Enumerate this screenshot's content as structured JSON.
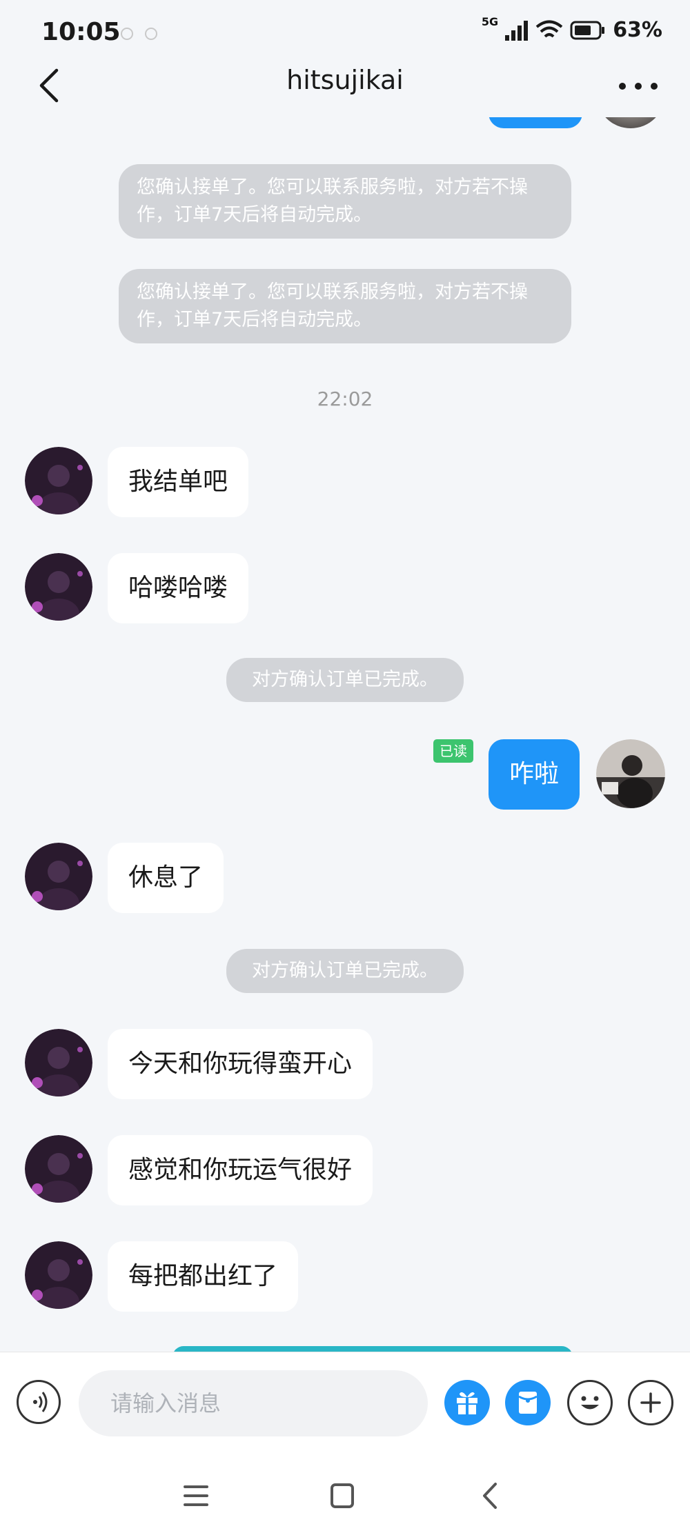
{
  "status_bar": {
    "time": "10:05",
    "network": "5G",
    "battery": "63%"
  },
  "header": {
    "title": "hitsujikai"
  },
  "system_messages": {
    "order_accepted_1": "您确认接单了。您可以联系服务啦，对方若不操作，订单7天后将自动完成。",
    "order_accepted_2": "您确认接单了。您可以联系服务啦，对方若不操作，订单7天后将自动完成。",
    "order_completed_1": "对方确认订单已完成。",
    "order_completed_2": "对方确认订单已完成。"
  },
  "timestamp": "22:02",
  "messages": {
    "m1": "我结单吧",
    "m2": "哈喽哈喽",
    "m3": "咋啦",
    "m4": "休息了",
    "m5": "今天和你玩得蛮开心",
    "m6": "感觉和你玩运气很好",
    "m7": "每把都出红了"
  },
  "read_status": "已读",
  "input": {
    "placeholder": "请输入消息"
  },
  "colors": {
    "accent": "#1f95f8",
    "read_badge": "#3cc46e",
    "system_bubble": "#d2d4d8"
  }
}
